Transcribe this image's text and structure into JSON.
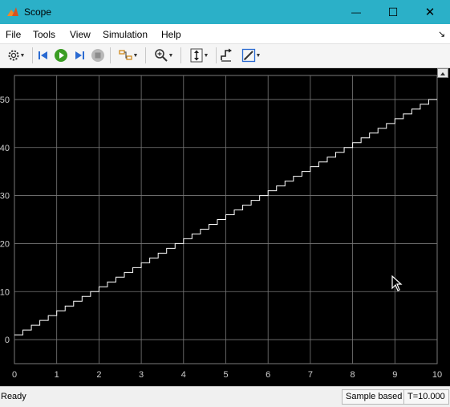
{
  "window": {
    "title": "Scope",
    "minimize_glyph": "—",
    "maximize_glyph": "☐",
    "close_glyph": "✕"
  },
  "menu": {
    "items": [
      {
        "label": "File"
      },
      {
        "label": "Tools"
      },
      {
        "label": "View"
      },
      {
        "label": "Simulation"
      },
      {
        "label": "Help"
      }
    ],
    "pin_glyph": "↘"
  },
  "toolbar": {
    "icons": [
      "gear-icon",
      "step-back-icon",
      "run-icon",
      "step-forward-icon",
      "stop-icon",
      "highlight-block-icon",
      "zoom-in-icon",
      "autoscale-icon",
      "write-data-icon",
      "styles-icon"
    ]
  },
  "plot": {
    "background": "#000000",
    "grid_color": "#7a7a7a",
    "line_color": "#ffffff",
    "tick_color": "#cfcfcf"
  },
  "chart_data": {
    "type": "line",
    "step": true,
    "x_range": [
      0,
      10
    ],
    "y_range": [
      -5,
      55
    ],
    "x_ticks": [
      0,
      1,
      2,
      3,
      4,
      5,
      6,
      7,
      8,
      9,
      10
    ],
    "y_ticks": [
      0,
      10,
      20,
      30,
      40,
      50
    ],
    "grid": true,
    "series": [
      {
        "x_start": 0,
        "x_end": 10,
        "x_step": 0.2,
        "y_start": 1,
        "y_step": 1
      }
    ]
  },
  "status": {
    "state": "Ready",
    "sample_mode": "Sample based",
    "time": "T=10.000"
  }
}
